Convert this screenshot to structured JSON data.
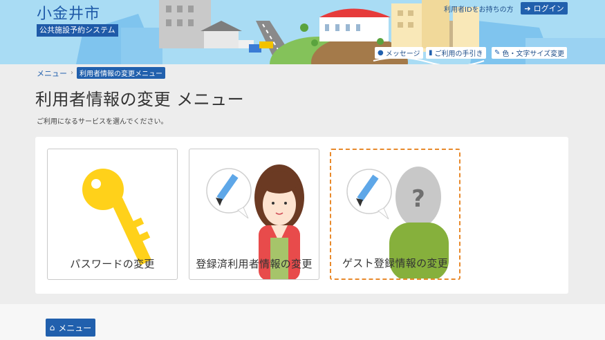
{
  "header": {
    "city_name": "小金井市",
    "system_name": "公共施設予約システム",
    "login_note": "利用者IDをお持ちの方",
    "login_label": "ログイン",
    "utilities": [
      {
        "label": "メッセージ",
        "icon": "speech-bubble-icon"
      },
      {
        "label": "ご利用の手引き",
        "icon": "book-icon"
      },
      {
        "label": "色・文字サイズ変更",
        "icon": "brush-icon"
      }
    ]
  },
  "breadcrumb": {
    "items": [
      "メニュー",
      "利用者情報の変更メニュー"
    ]
  },
  "page": {
    "title": "利用者情報の変更 メニュー",
    "instruction": "ご利用になるサービスを選んでください。"
  },
  "cards": [
    {
      "label": "パスワードの変更",
      "icon": "key-icon"
    },
    {
      "label": "登録済利用者情報の変更",
      "icon": "registered-user-icon"
    },
    {
      "label": "ゲスト登録情報の変更",
      "icon": "guest-user-icon"
    }
  ],
  "footer": {
    "menu_label": "メニュー",
    "menu_icon": "home-icon"
  },
  "colors": {
    "brand_blue": "#2160ad",
    "header_sky": "#a9dcf4",
    "focus_orange": "#e8892a",
    "key_yellow": "#ffd11a"
  }
}
